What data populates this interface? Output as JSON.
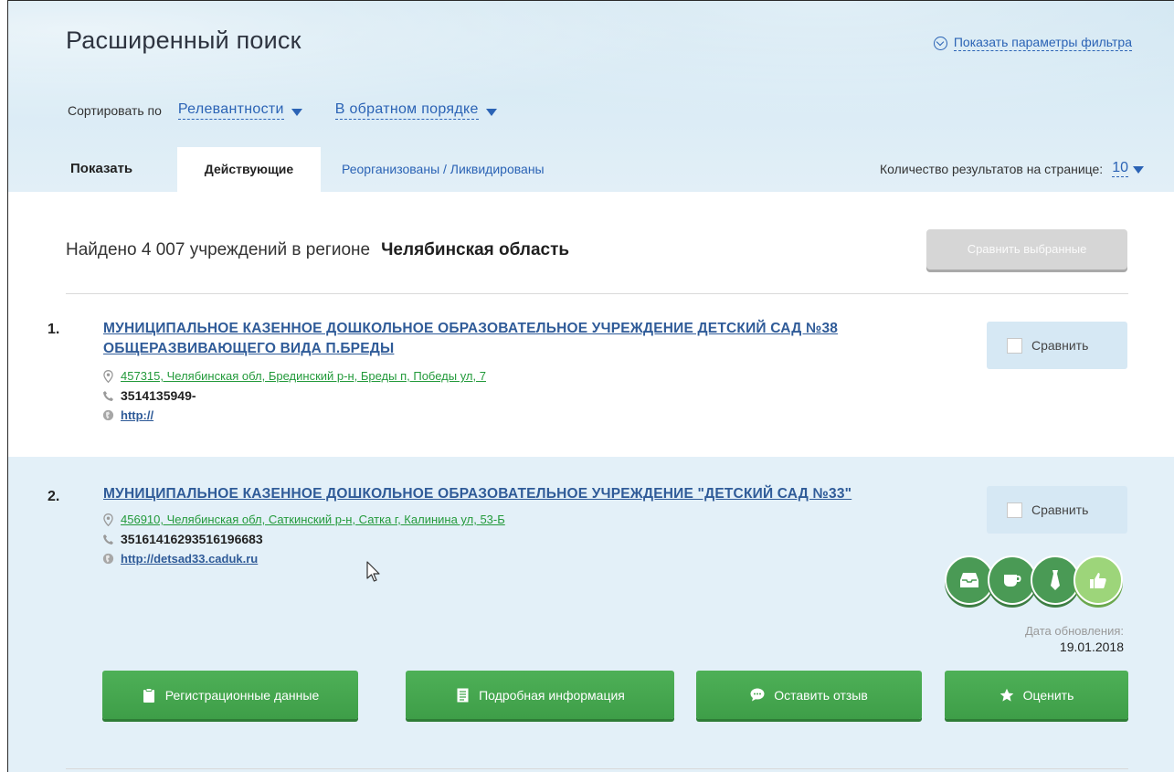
{
  "header": {
    "title": "Расширенный поиск",
    "filter_link": "Показать параметры фильтра",
    "sort_label": "Сортировать по",
    "sort_field": "Релевантности",
    "sort_order": "В обратном порядке",
    "show_label": "Показать",
    "tabs": [
      {
        "label": "Действующие",
        "active": true
      },
      {
        "label": "Реорганизованы / Ликвидированы",
        "active": false
      }
    ],
    "per_page_label": "Количество результатов на странице:",
    "per_page_value": "10"
  },
  "summary": {
    "found_text": "Найдено 4 007 учреждений  в регионе",
    "region": "Челябинская область",
    "compare_selected": "Сравнить выбранные"
  },
  "results": [
    {
      "num": "1.",
      "title_line1": "МУНИЦИПАЛЬНОЕ КАЗЕННОЕ ДОШКОЛЬНОЕ ОБРАЗОВАТЕЛЬНОЕ УЧРЕЖДЕНИЕ ДЕТСКИЙ САД №38",
      "title_line2": "ОБЩЕРАЗВИВАЮЩЕГО ВИДА П.БРЕДЫ",
      "address": "457315, Челябинская обл, Брединский р-н, Бреды п, Победы ул, 7",
      "phone": "3514135949-",
      "website": "http://",
      "compare": "Сравнить"
    },
    {
      "num": "2.",
      "title_line1": "МУНИЦИПАЛЬНОЕ КАЗЕННОЕ ДОШКОЛЬНОЕ ОБРАЗОВАТЕЛЬНОЕ УЧРЕЖДЕНИЕ \"ДЕТСКИЙ САД №33\"",
      "address": "456910, Челябинская обл, Саткинский р-н, Сатка г, Калинина ул, 53-Б",
      "phone": "35161416293516196683",
      "website": "http://detsad33.caduk.ru",
      "compare": "Сравнить",
      "update_label": "Дата обновления:",
      "update_date": "19.01.2018",
      "badges": [
        "inbox-icon",
        "cup-icon",
        "tie-icon",
        "thumbs-up-icon"
      ],
      "actions": [
        {
          "label": "Регистрационные данные",
          "icon": "clipboard-icon"
        },
        {
          "label": "Подробная информация",
          "icon": "document-icon"
        },
        {
          "label": "Оставить отзыв",
          "icon": "speech-bubble-icon"
        },
        {
          "label": "Оценить",
          "icon": "star-icon"
        }
      ]
    }
  ],
  "colors": {
    "link_blue": "#2b63b5",
    "address_green": "#239a3b",
    "button_green": "#45a74f",
    "header_bg": "#d9ebf5"
  }
}
